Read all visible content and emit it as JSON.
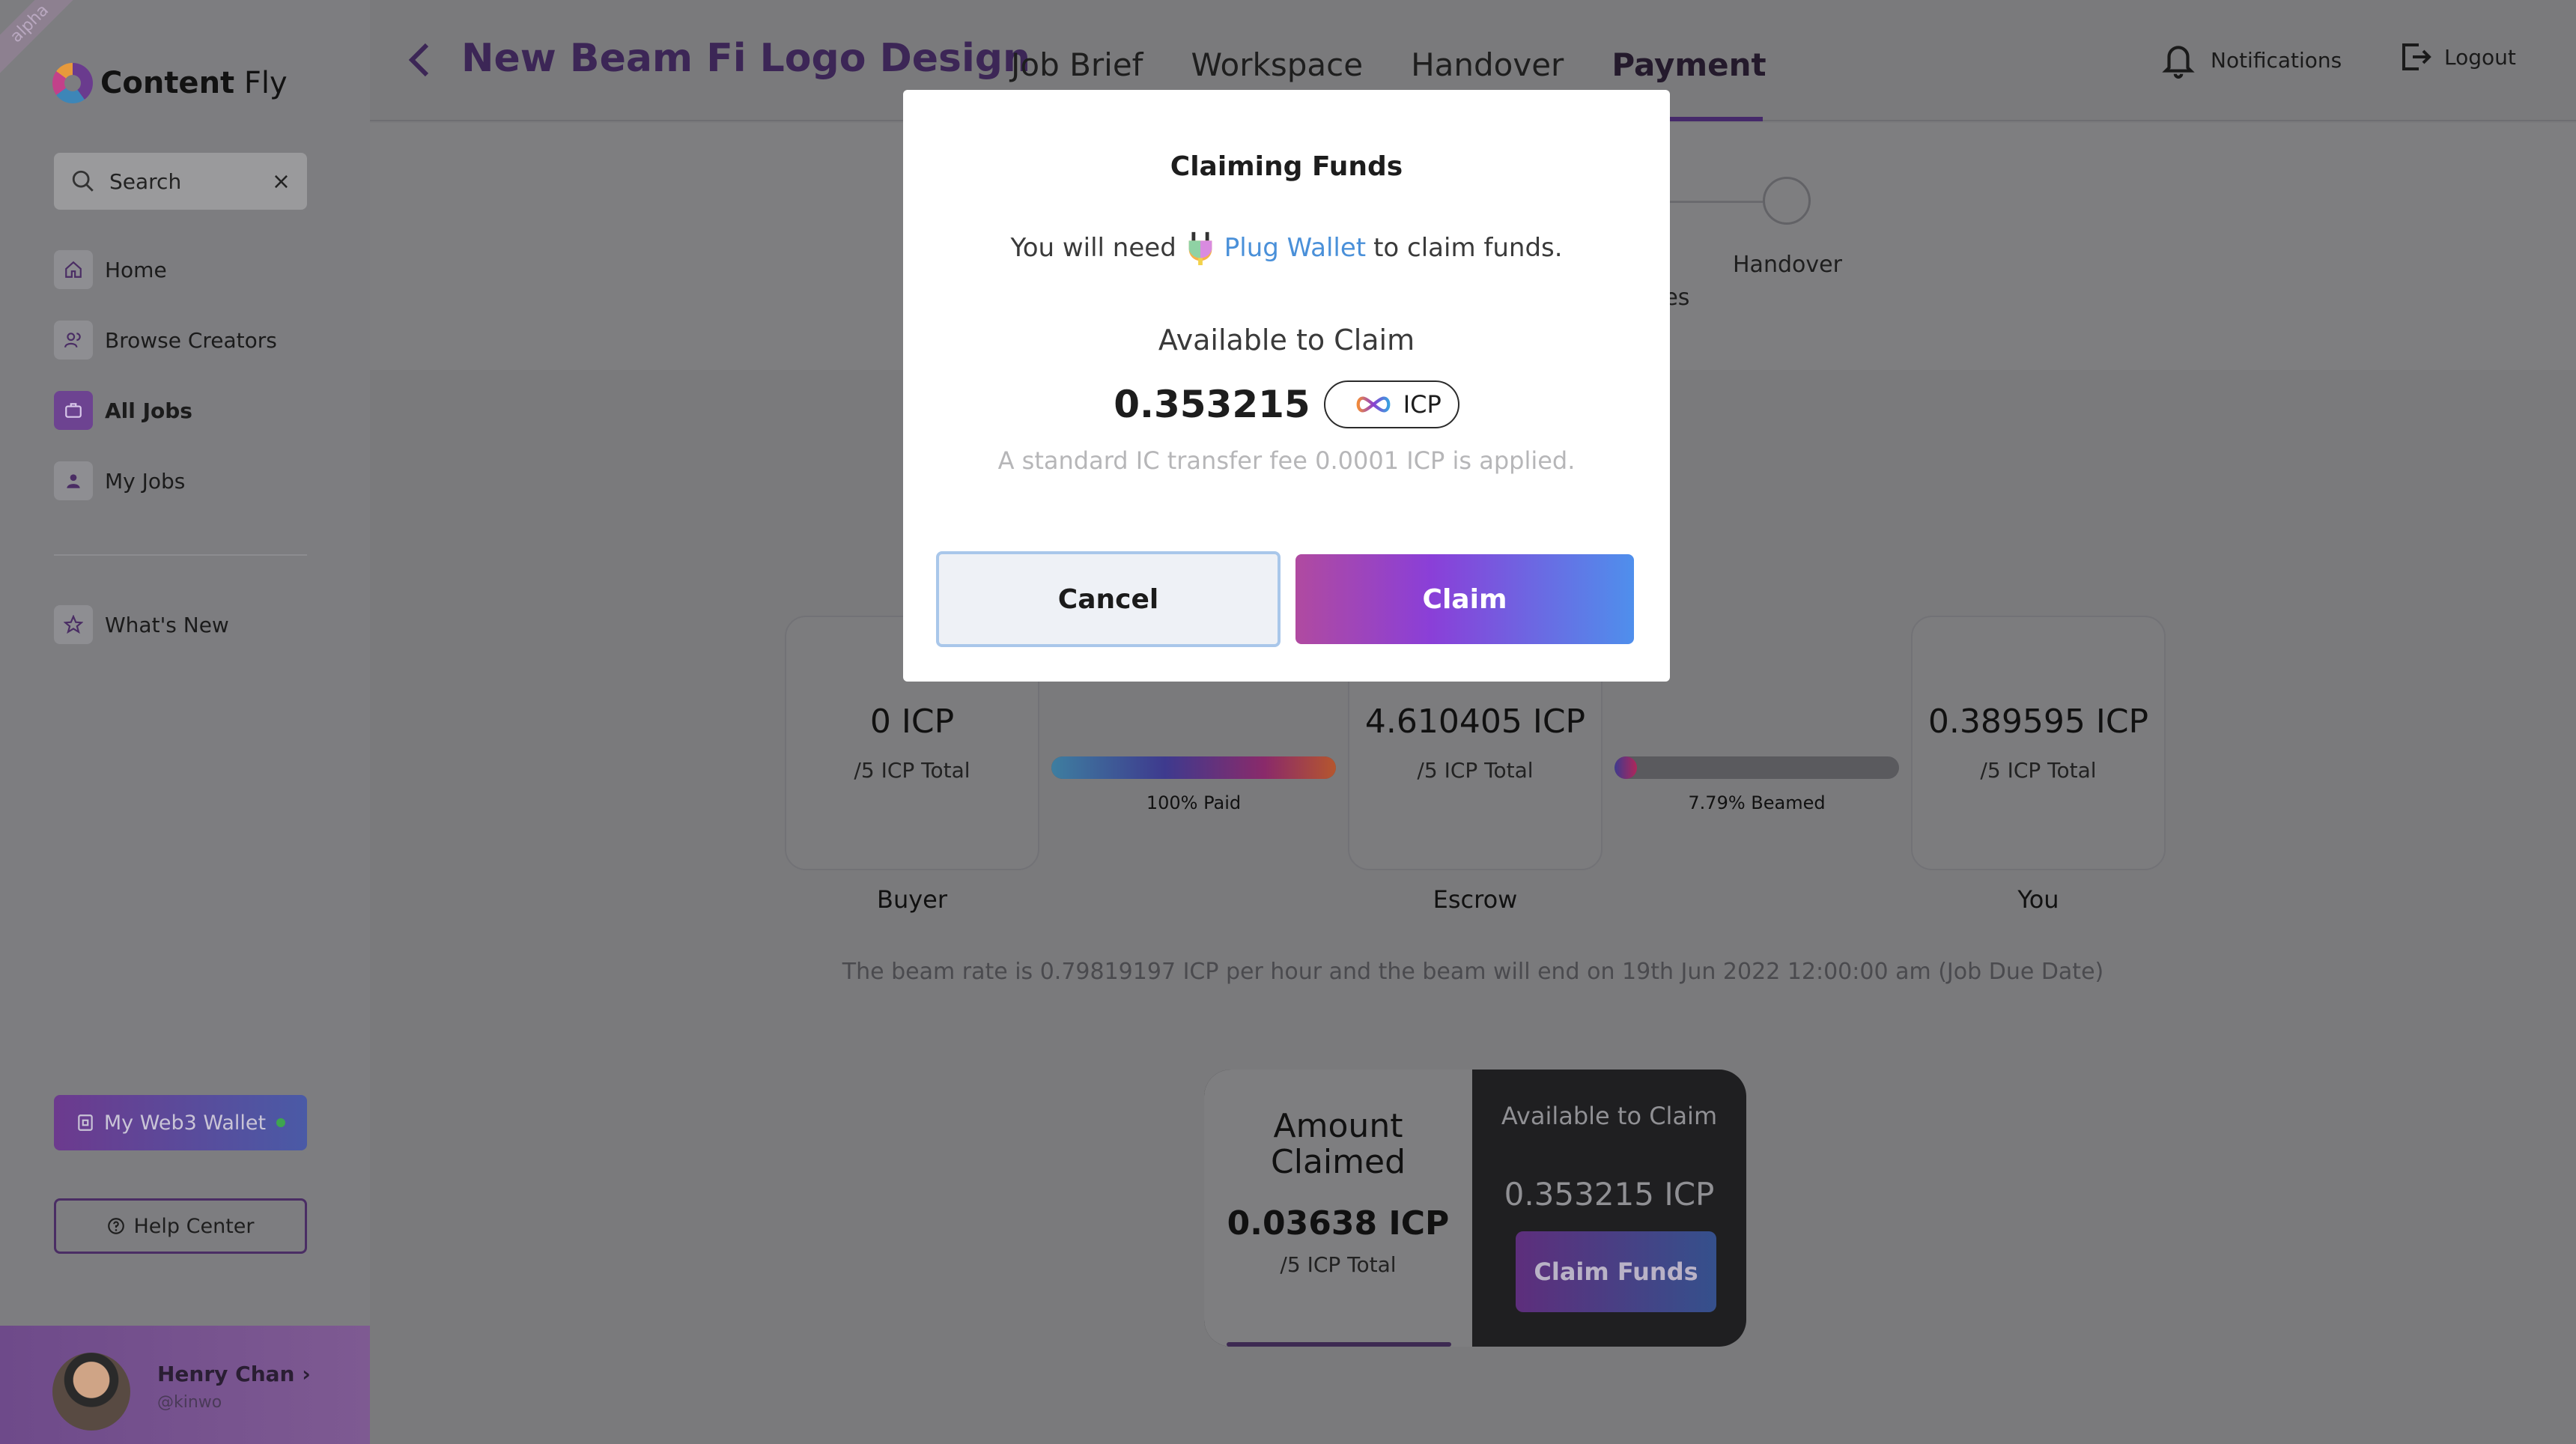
{
  "sidebar": {
    "ribbon": "alpha",
    "brand": {
      "name_bold": "Content",
      "name_rest": " Fly"
    },
    "search": {
      "placeholder": "Search"
    },
    "nav": [
      {
        "label": "Home",
        "icon": "home-icon"
      },
      {
        "label": "Browse Creators",
        "icon": "users-icon"
      },
      {
        "label": "All Jobs",
        "icon": "briefcase-icon",
        "active": true
      },
      {
        "label": "My Jobs",
        "icon": "user-icon"
      }
    ],
    "whats_new": "What's New",
    "wallet_button": "My Web3 Wallet",
    "help_button": "Help Center",
    "profile": {
      "name": "Henry Chan",
      "handle": "@kinwo"
    }
  },
  "header": {
    "job_title": "New Beam Fi Logo Design",
    "tabs": [
      "Job Brief",
      "Workspace",
      "Handover",
      "Payment"
    ],
    "active_tab": "Payment",
    "notifications": "Notifications",
    "logout": "Logout"
  },
  "steps": {
    "label_handover": "Handover",
    "label_partial": "les"
  },
  "payment": {
    "buyer": {
      "amount": "0 ICP",
      "total": "/5 ICP Total",
      "caption": "Buyer"
    },
    "escrow": {
      "amount": "4.610405 ICP",
      "total": "/5 ICP Total",
      "caption": "Escrow"
    },
    "you": {
      "amount": "0.389595 ICP",
      "total": "/5 ICP Total",
      "caption": "You"
    },
    "paid_bar": {
      "label": "100% Paid",
      "fraction": 1.0
    },
    "beamed_bar": {
      "label": "7.79% Beamed",
      "fraction": 0.0779
    },
    "beam_rate_text": "The beam rate is 0.79819197 ICP per hour and the beam will end on 19th Jun 2022 12:00:00 am (Job Due Date)"
  },
  "claim_panel": {
    "claimed_title": "Amount Claimed",
    "claimed_amount": "0.03638 ICP",
    "claimed_total": "/5 ICP Total",
    "available_title": "Available to Claim",
    "available_amount": "0.353215 ICP",
    "button": "Claim Funds"
  },
  "modal": {
    "title": "Claiming Funds",
    "need_prefix": "You will need",
    "wallet_link": "Plug Wallet",
    "need_suffix": "to claim funds.",
    "available_label": "Available to Claim",
    "amount": "0.353215",
    "currency": "ICP",
    "fee_note": "A standard IC transfer fee 0.0001 ICP is applied.",
    "cancel": "Cancel",
    "claim": "Claim"
  },
  "colors": {
    "accent": "#6d4391",
    "link": "#4a90d9"
  }
}
